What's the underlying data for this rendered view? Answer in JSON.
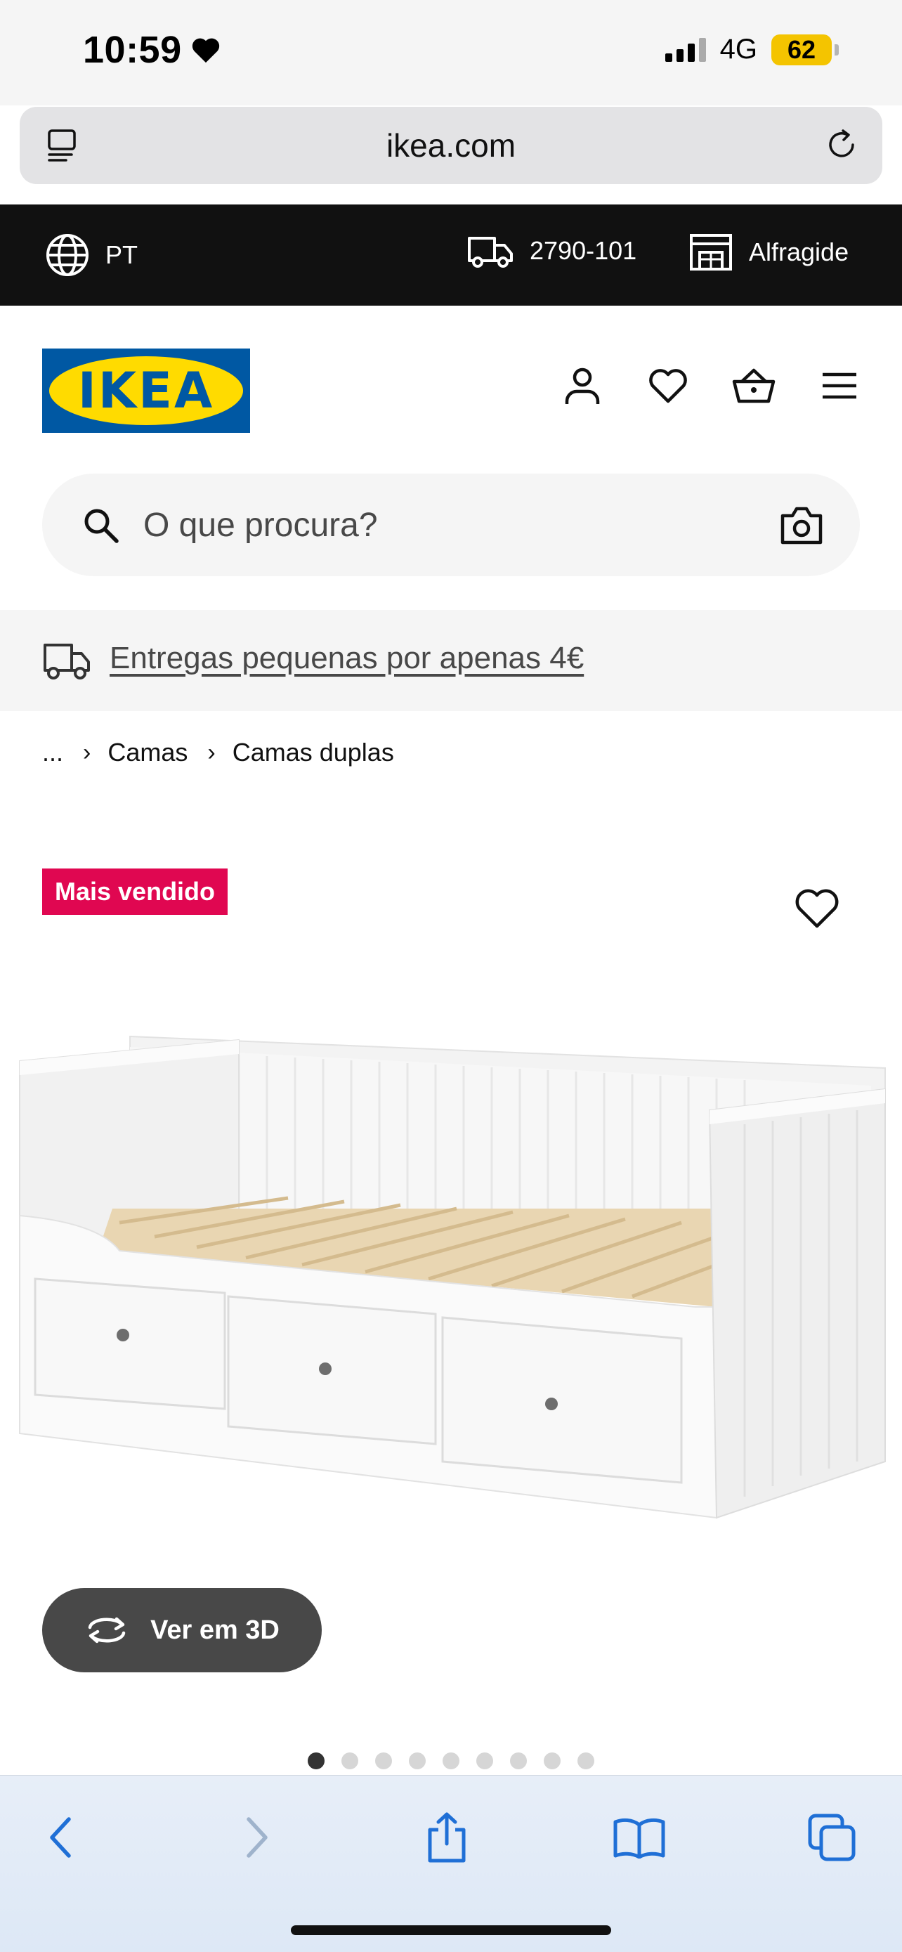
{
  "status_bar": {
    "time": "10:59",
    "network": "4G",
    "battery": "62"
  },
  "browser": {
    "url": "ikea.com"
  },
  "top_bar": {
    "language": "PT",
    "postal_code": "2790-101",
    "store": "Alfragide"
  },
  "header": {
    "logo_text": "IKEA"
  },
  "search": {
    "placeholder": "O que procura?"
  },
  "promo": {
    "text": "Entregas pequenas por apenas 4€"
  },
  "breadcrumb": {
    "ellipsis": "...",
    "items": [
      "Camas",
      "Camas duplas"
    ]
  },
  "product": {
    "badge": "Mais vendido",
    "view_3d_label": "Ver em 3D",
    "image_count": 9,
    "active_image": 0
  },
  "colors": {
    "ikea_blue": "#0058a3",
    "ikea_yellow": "#ffdb00",
    "badge_red": "#e00751",
    "dark_button": "#484848"
  }
}
